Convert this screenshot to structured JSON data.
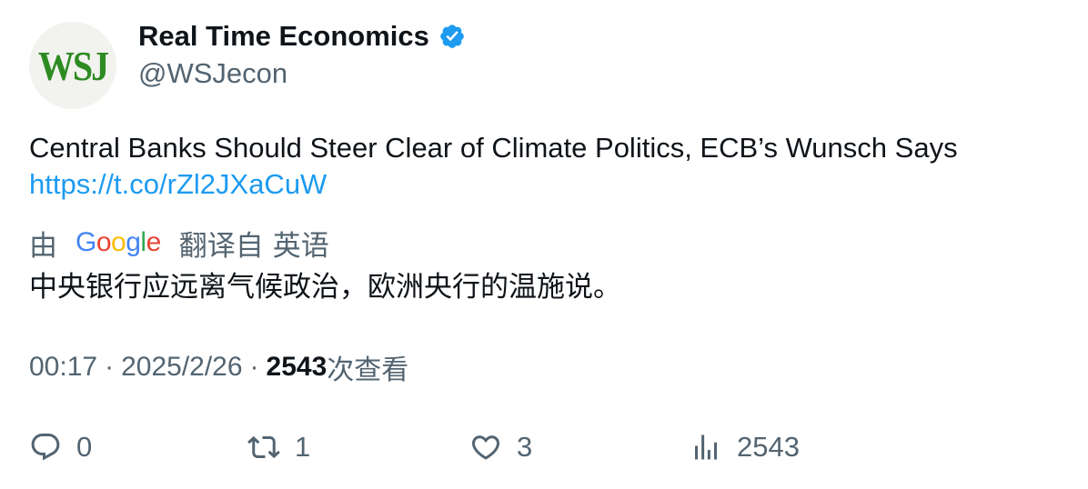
{
  "author": {
    "avatar_text": "WSJ",
    "display_name": "Real Time Economics",
    "handle": "@WSJecon",
    "verified_icon": "verified-badge-icon",
    "brand_color": "#2e8b22"
  },
  "tweet": {
    "text": "Central Banks Should Steer Clear of Climate Politics, ECB’s Wunsch Says",
    "link": "https://t.co/rZl2JXaCuW",
    "link_color": "#1d9bf0"
  },
  "translation": {
    "prefix": "由",
    "provider_letters": [
      "G",
      "o",
      "o",
      "g",
      "l",
      "e"
    ],
    "suffix": "翻译自",
    "language": "英语",
    "text": "中央银行应远离气候政治，欧洲央行的温施说。"
  },
  "meta": {
    "time": "00:17",
    "separator": "·",
    "date": "2025/2/26",
    "views_count": "2543",
    "views_label": "次查看"
  },
  "actions": {
    "reply": {
      "icon": "reply-icon",
      "count": "0"
    },
    "retweet": {
      "icon": "retweet-icon",
      "count": "1"
    },
    "like": {
      "icon": "heart-icon",
      "count": "3"
    },
    "views": {
      "icon": "views-chart-icon",
      "count": "2543"
    },
    "icon_color": "#536471"
  }
}
